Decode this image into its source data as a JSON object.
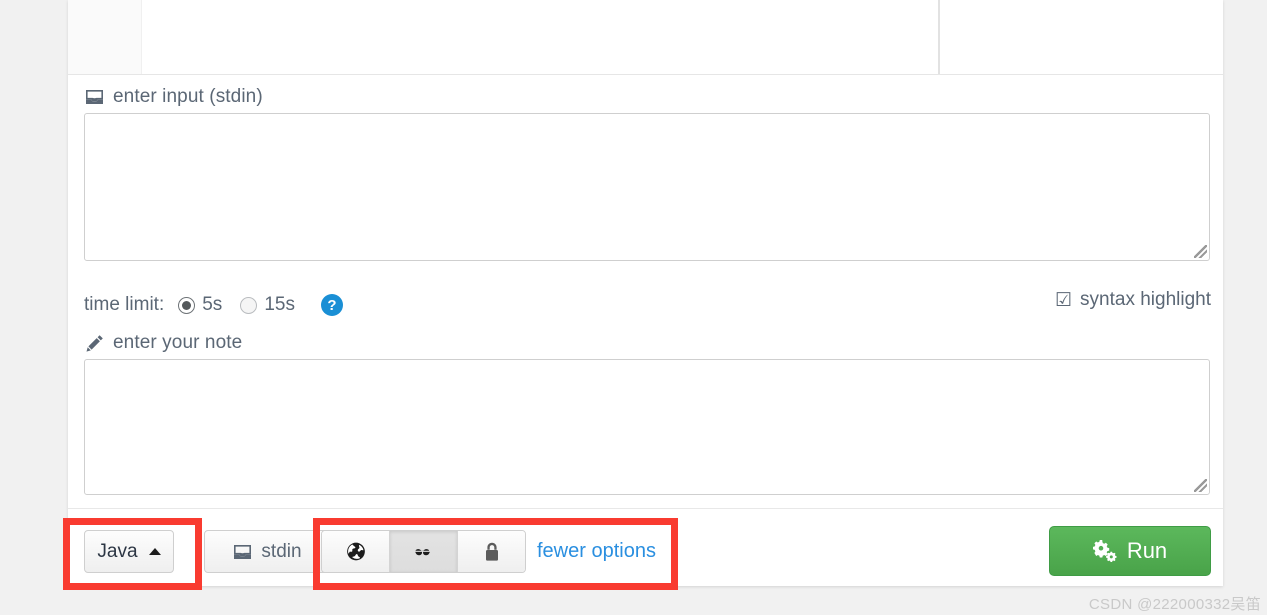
{
  "editor": {
    "gutter_label": "",
    "code": ""
  },
  "stdin_section": {
    "icon": "inbox-icon",
    "label": "enter input (stdin)",
    "value": "",
    "placeholder": ""
  },
  "options": {
    "time_limit_label": "time limit:",
    "radios": [
      {
        "label": "5s",
        "selected": true
      },
      {
        "label": "15s",
        "selected": false
      }
    ],
    "help_glyph": "?",
    "help_color": "#1a8fd5",
    "syntax_highlight": {
      "label": "syntax highlight",
      "checked": true,
      "glyph": "☑"
    }
  },
  "note_section": {
    "icon": "pencil-icon",
    "label": "enter your note",
    "value": "",
    "placeholder": ""
  },
  "toolbar": {
    "language_button": {
      "label": "Java",
      "caret": "caret-up-icon"
    },
    "stdin_button": {
      "label": "stdin",
      "icon": "inbox-icon"
    },
    "visibility_group": [
      {
        "name": "public",
        "icon": "globe-icon",
        "active": false
      },
      {
        "name": "secret",
        "icon": "glasses-icon",
        "active": true
      },
      {
        "name": "private",
        "icon": "lock-icon",
        "active": false
      }
    ],
    "fewer_options_label": "fewer options",
    "fewer_options_color": "#2a8fe0",
    "run_button": {
      "label": "Run",
      "icon": "cogs-icon",
      "color": "#5cb85c"
    }
  },
  "annotations": {
    "color": "#f93b30",
    "boxes": [
      {
        "name": "language-selector-highlight"
      },
      {
        "name": "visibility-options-highlight"
      }
    ]
  },
  "watermark": {
    "text": "CSDN @222000332吴笛"
  }
}
